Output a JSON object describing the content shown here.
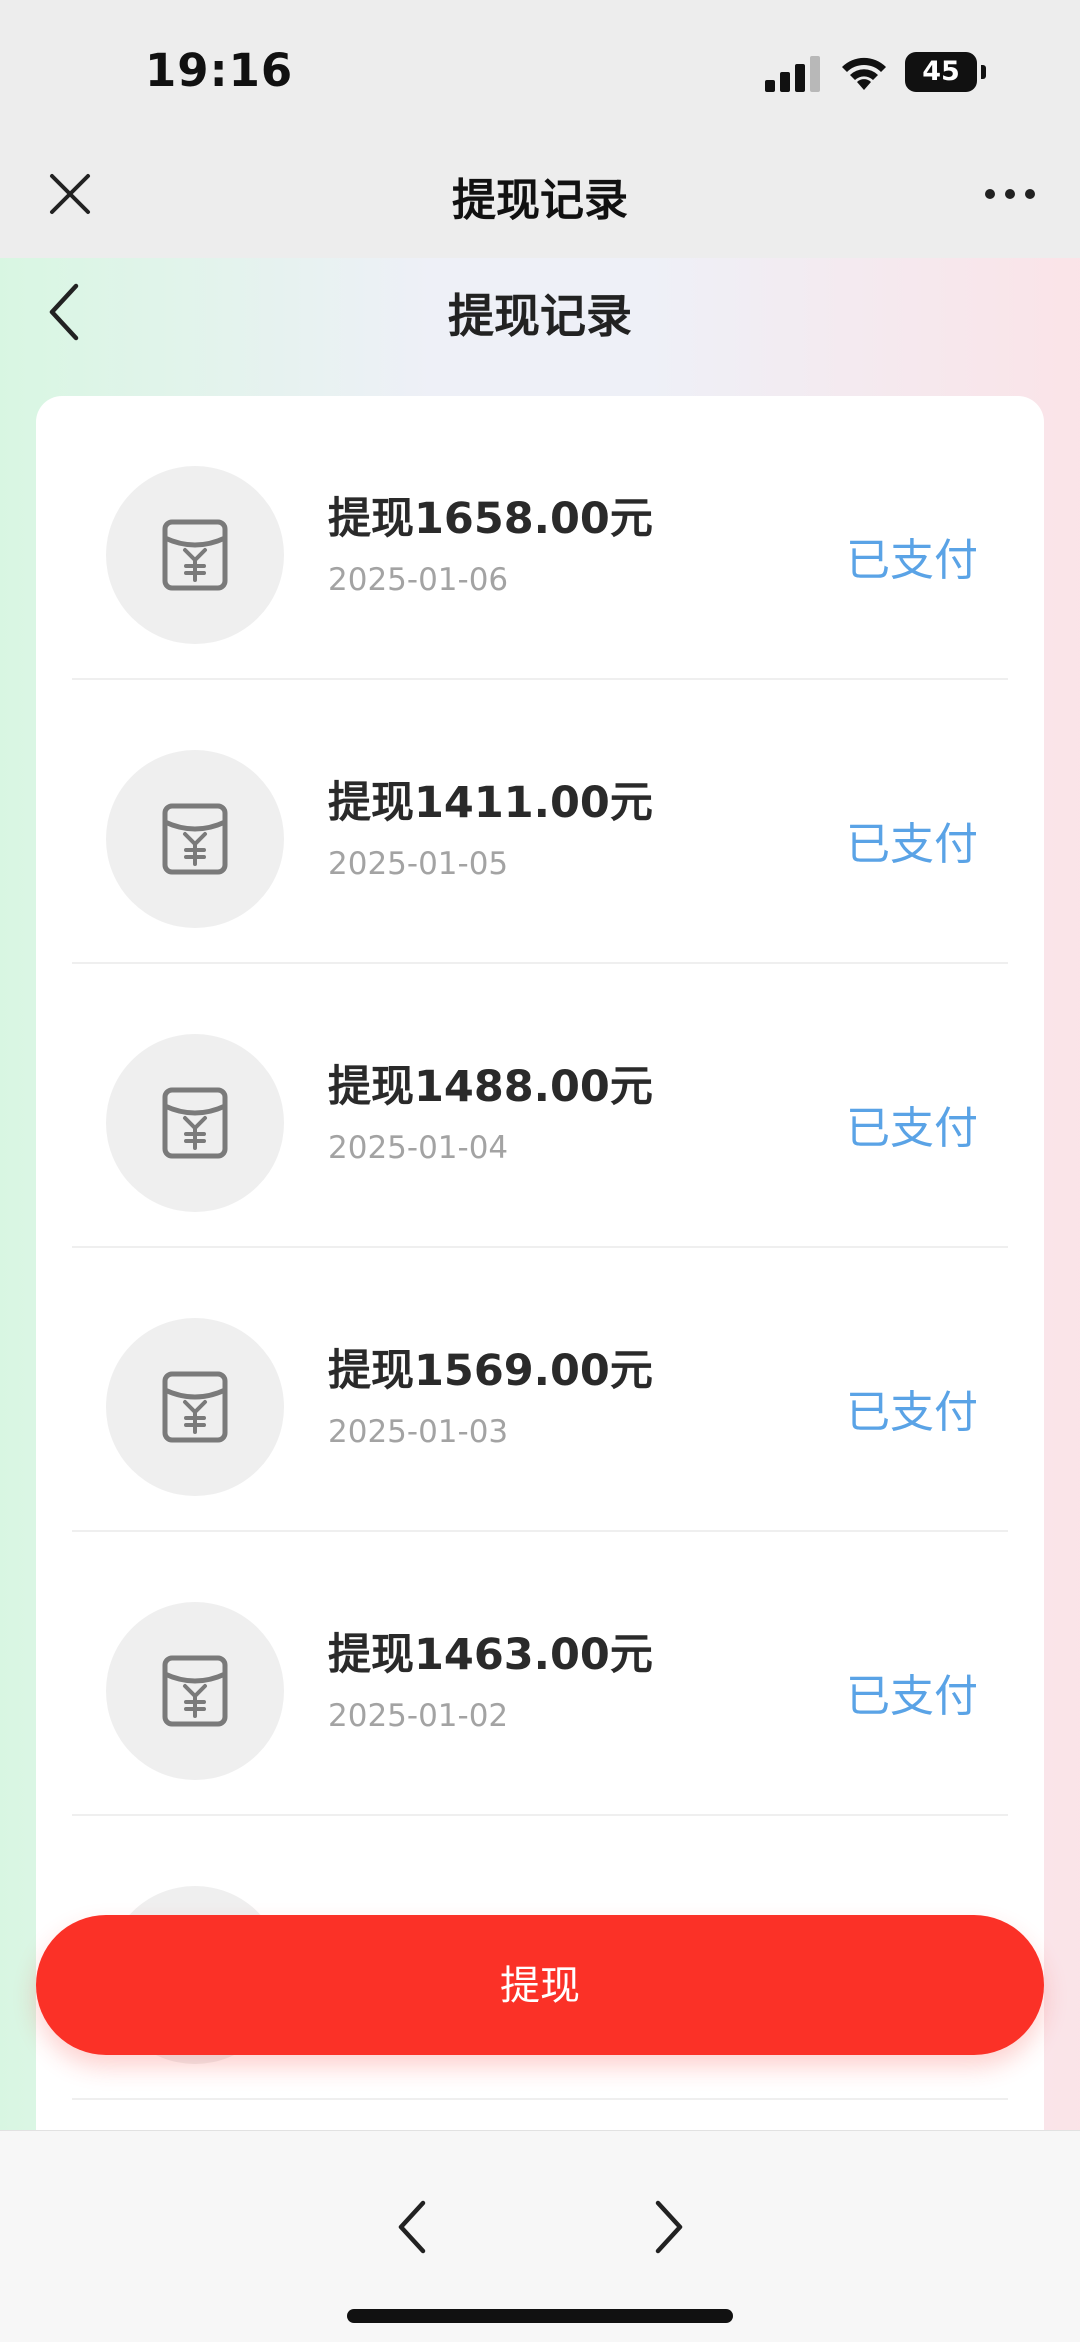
{
  "status_bar": {
    "time": "19:16",
    "battery": "45"
  },
  "top_nav": {
    "title": "提现记录"
  },
  "page": {
    "title": "提现记录"
  },
  "records": [
    {
      "amount": "提现1658.00元",
      "date": "2025-01-06",
      "status": "已支付"
    },
    {
      "amount": "提现1411.00元",
      "date": "2025-01-05",
      "status": "已支付"
    },
    {
      "amount": "提现1488.00元",
      "date": "2025-01-04",
      "status": "已支付"
    },
    {
      "amount": "提现1569.00元",
      "date": "2025-01-03",
      "status": "已支付"
    },
    {
      "amount": "提现1463.00元",
      "date": "2025-01-02",
      "status": "已支付"
    }
  ],
  "withdraw_button": {
    "label": "提现"
  },
  "colors": {
    "accent_blue": "#5aa3e6",
    "button_red": "#fb3127"
  }
}
